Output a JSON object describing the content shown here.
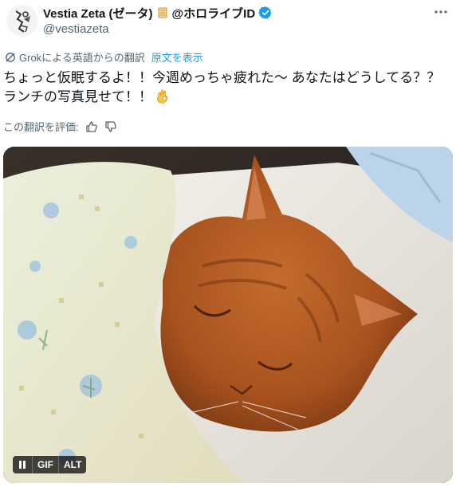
{
  "author": {
    "display_name": "Vestia Zeta (ゼータ)",
    "affiliation": "@ホロライブID",
    "handle": "@vestiazeta",
    "verified_color": "#1d9bf0"
  },
  "translation": {
    "notice": "Grokによる英語からの翻訳",
    "show_original": "原文を表示",
    "rate_label": "この翻訳を評価:"
  },
  "tweet": {
    "text": "ちょっと仮眠するよ！！今週めっちゃ疲れた〜 あなたはどうしてる？？\nランチの写真見せて！！"
  },
  "media": {
    "subject": "orange-tabby-cat-sleeping-under-blanket",
    "pause_icon": "pause-icon",
    "gif_label": "GIF",
    "alt_label": "ALT"
  },
  "icons": {
    "more": "more-icon",
    "grok": "grok-icon",
    "thumbs_up": "thumbs-up-icon",
    "thumbs_down": "thumbs-down-icon"
  },
  "colors": {
    "link": "#1d9bf0",
    "secondary": "#536471",
    "primary": "#0f1419"
  }
}
